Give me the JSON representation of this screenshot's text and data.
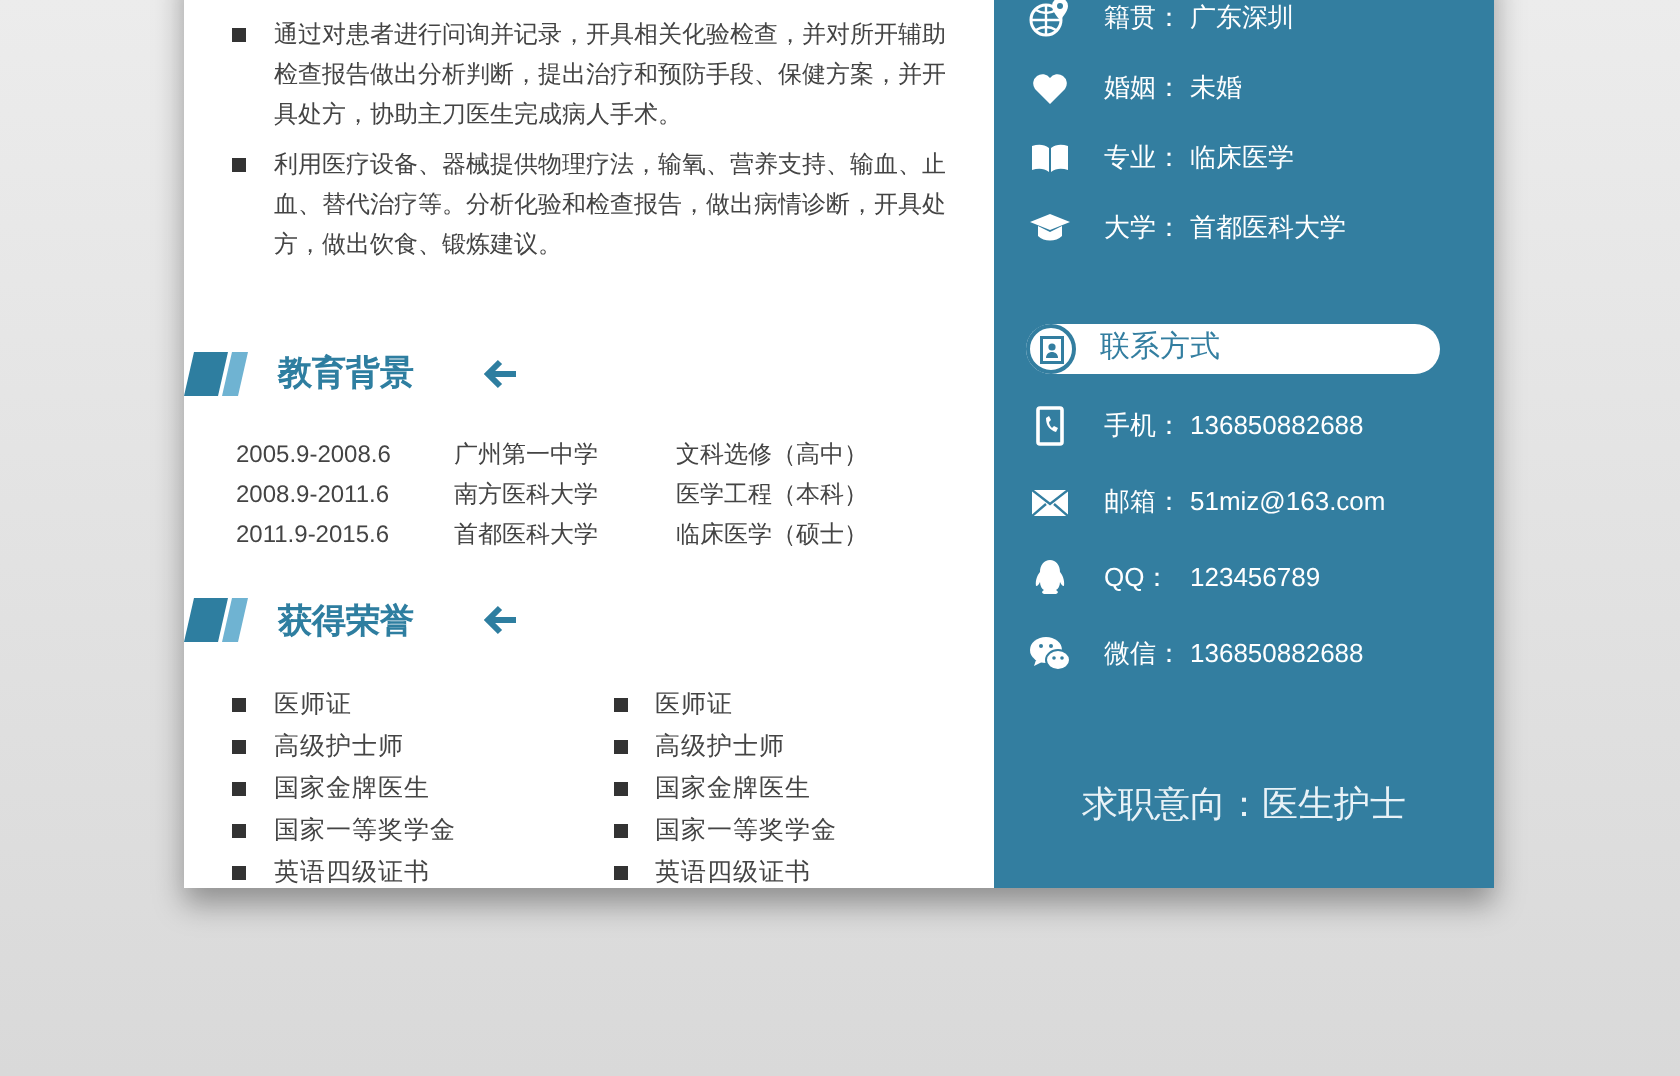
{
  "experience_bullets": [
    "通过对患者进行问询并记录，开具相关化验检查，并对所开辅助检查报告做出分析判断，提出治疗和预防手段、保健方案，并开具处方，协助主刀医生完成病人手术。",
    "利用医疗设备、器械提供物理疗法，输氧、营养支持、输血、止血、替代治疗等。分析化验和检查报告，做出病情诊断，开具处方，做出饮食、锻炼建议。"
  ],
  "education": {
    "title": "教育背景",
    "rows": [
      {
        "period": "2005.9-2008.6",
        "school": "广州第一中学",
        "major": "文科选修（高中）"
      },
      {
        "period": "2008.9-2011.6",
        "school": "南方医科大学",
        "major": "医学工程（本科）"
      },
      {
        "period": "2011.9-2015.6",
        "school": "首都医科大学",
        "major": "临床医学（硕士）"
      }
    ]
  },
  "honors": {
    "title": "获得荣誉",
    "columns": [
      [
        "医师证",
        "高级护士师",
        "国家金牌医生",
        "国家一等奖学金",
        "英语四级证书"
      ],
      [
        "医师证",
        "高级护士师",
        "国家金牌医生",
        "国家一等奖学金",
        "英语四级证书"
      ]
    ]
  },
  "personal_info": [
    {
      "kind": "globe",
      "label": "籍贯：",
      "value": "广东深圳"
    },
    {
      "kind": "heart",
      "label": "婚姻：",
      "value": "未婚"
    },
    {
      "kind": "book",
      "label": "专业：",
      "value": "临床医学"
    },
    {
      "kind": "cap",
      "label": "大学：",
      "value": "首都医科大学"
    }
  ],
  "contact": {
    "title": "联系方式",
    "rows": [
      {
        "kind": "phone",
        "label": "手机：",
        "value": "136850882688"
      },
      {
        "kind": "mail",
        "label": "邮箱：",
        "value": "51miz@163.com"
      },
      {
        "kind": "qq",
        "label": "QQ：",
        "value": "123456789"
      },
      {
        "kind": "wechat",
        "label": "微信：",
        "value": "136850882688"
      }
    ]
  },
  "job_objective": "求职意向：医生护士"
}
